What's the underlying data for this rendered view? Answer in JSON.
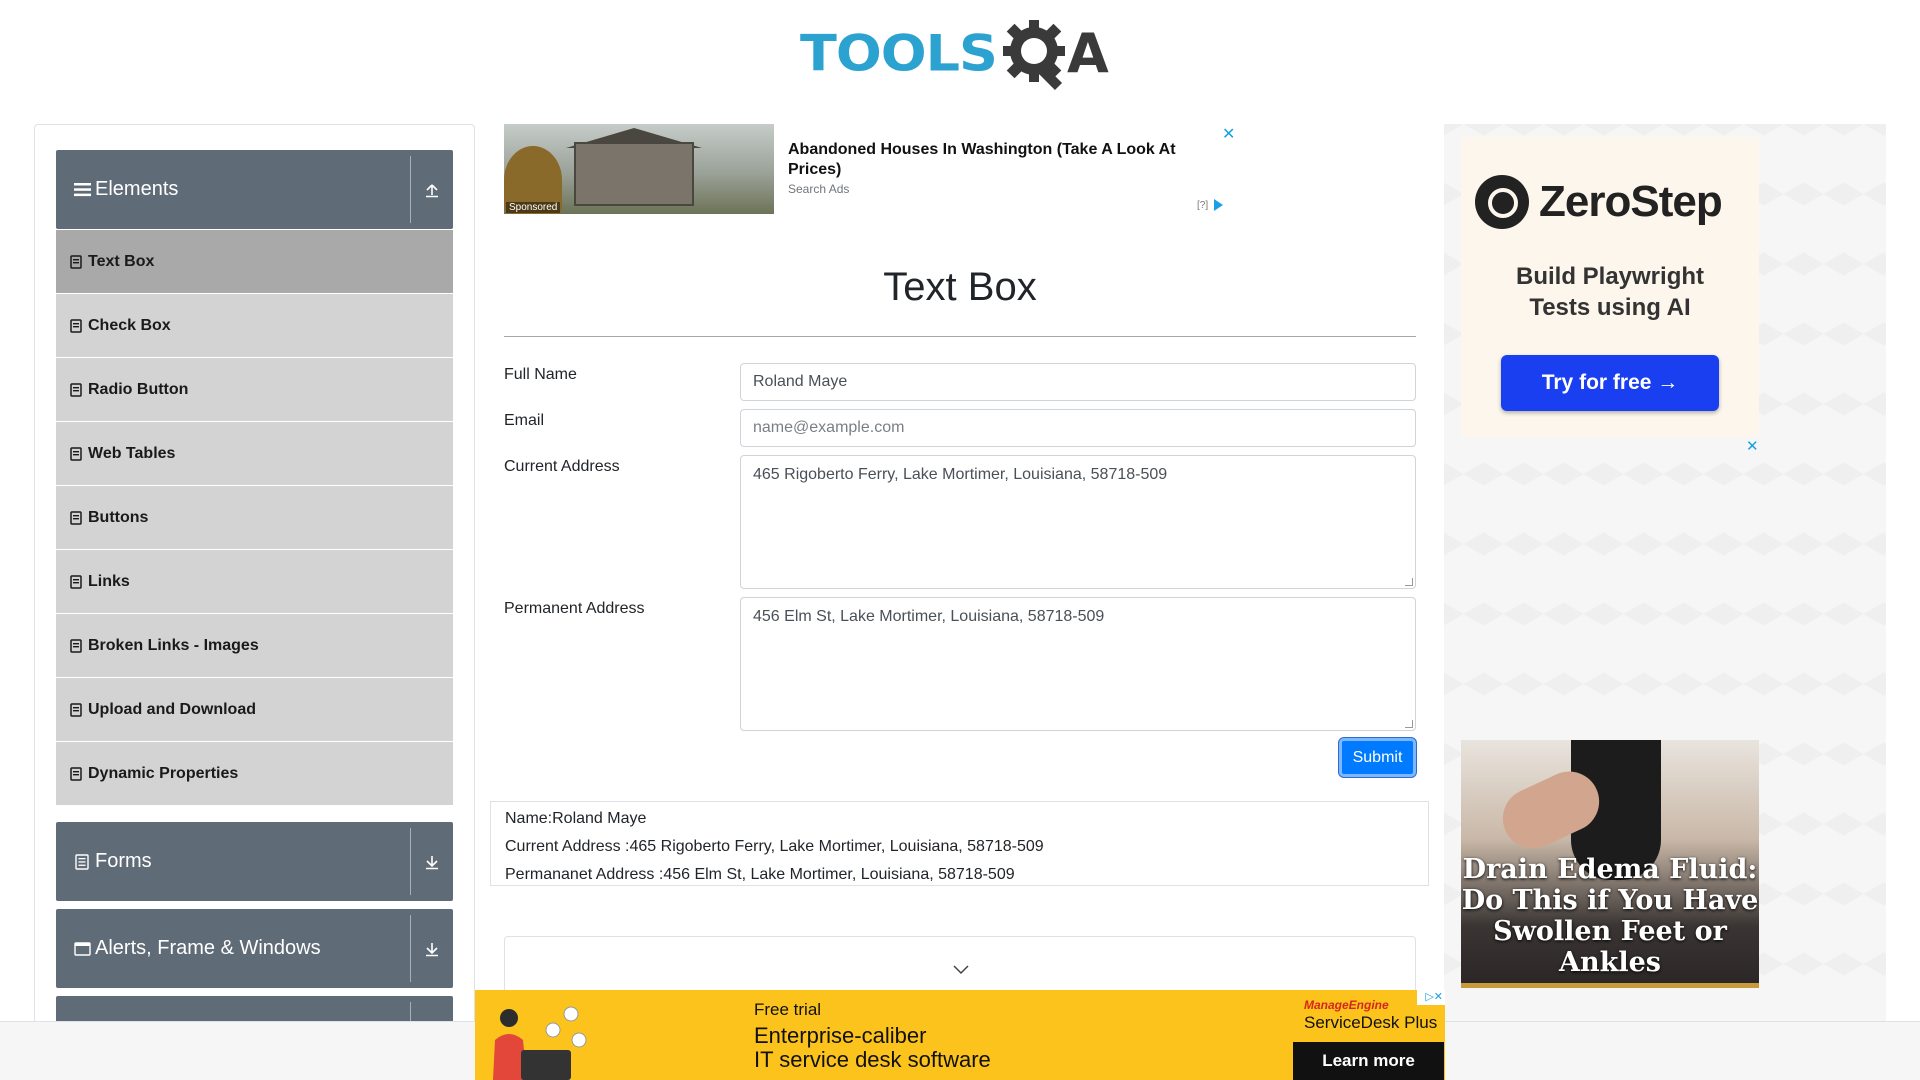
{
  "header": {
    "logo_text": "TOOLSQA"
  },
  "sidebar": {
    "groups": [
      {
        "label": "Elements",
        "expanded": true,
        "items": [
          {
            "label": "Text Box",
            "active": true
          },
          {
            "label": "Check Box"
          },
          {
            "label": "Radio Button"
          },
          {
            "label": "Web Tables"
          },
          {
            "label": "Buttons"
          },
          {
            "label": "Links"
          },
          {
            "label": "Broken Links - Images"
          },
          {
            "label": "Upload and Download"
          },
          {
            "label": "Dynamic Properties"
          }
        ]
      },
      {
        "label": "Forms",
        "expanded": false
      },
      {
        "label": "Alerts, Frame & Windows",
        "expanded": false
      }
    ]
  },
  "top_ad": {
    "badge": "Sponsored",
    "title": "Abandoned Houses In Washington (Take A Look At Prices)",
    "source": "Search Ads",
    "close": "✕",
    "info": "[?]"
  },
  "main": {
    "title": "Text Box",
    "form": {
      "full_name_label": "Full Name",
      "full_name_value": "Roland Maye",
      "email_label": "Email",
      "email_placeholder": "name@example.com",
      "current_address_label": "Current Address",
      "current_address_value": "465 Rigoberto Ferry, Lake Mortimer, Louisiana, 58718-509",
      "permanent_address_label": "Permanent Address",
      "permanent_address_value": "456 Elm St, Lake Mortimer, Louisiana, 58718-509",
      "submit_label": "Submit"
    },
    "output": {
      "name": "Name:Roland Maye",
      "current_address": "Current Address :465 Rigoberto Ferry, Lake Mortimer, Louisiana, 58718-509",
      "permanent_address": "Permananet Address :456 Elm St, Lake Mortimer, Louisiana, 58718-509"
    }
  },
  "right_ads": {
    "zerostep": {
      "brand": "ZeroStep",
      "tagline_1": "Build Playwright",
      "tagline_2": "Tests using AI",
      "cta": "Try for free →"
    },
    "edema": {
      "headline": "Drain Edema Fluid: Do This if You Have Swollen Feet or Ankles"
    },
    "close": "✕"
  },
  "bottom_ad": {
    "kicker": "Free trial",
    "line1": "Enterprise-caliber",
    "line2": "IT service desk software",
    "brand": "ManageEngine",
    "product": "ServiceDesk Plus",
    "cta": "Learn more",
    "close": "▷✕"
  },
  "colors": {
    "sidebar_header": "#5f6b76",
    "sidebar_item": "#d3d3d3",
    "sidebar_item_active": "#a9a9a9",
    "primary_button": "#007bff",
    "logo_blue": "#2ba2cf",
    "ad_close_blue": "#1aa1e3"
  }
}
